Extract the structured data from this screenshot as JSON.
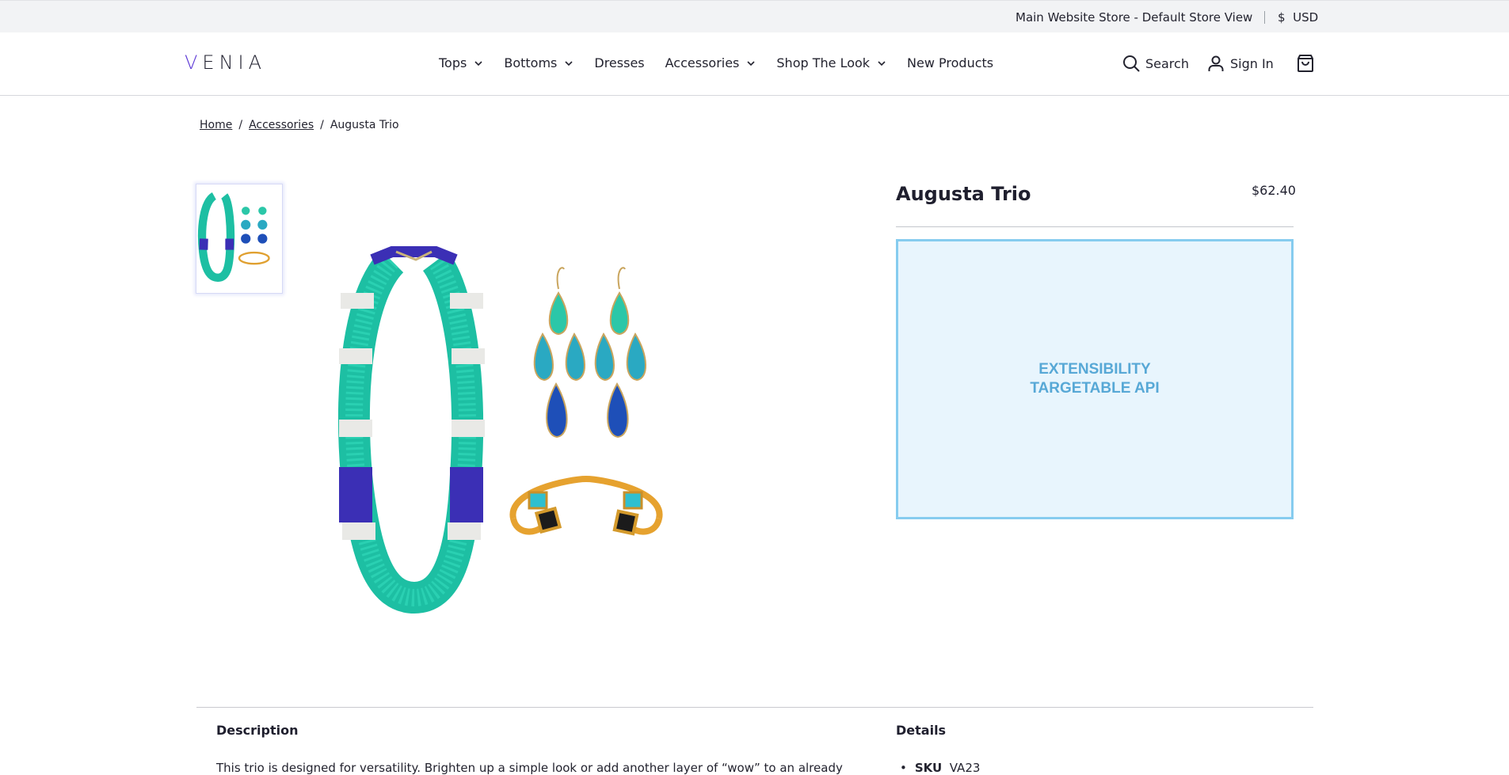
{
  "topbar": {
    "store_view": "Main Website Store - Default Store View",
    "currency_symbol": "$",
    "currency": "USD"
  },
  "header": {
    "logo": "VENIA",
    "nav": [
      {
        "label": "Tops",
        "has_dropdown": true
      },
      {
        "label": "Bottoms",
        "has_dropdown": true
      },
      {
        "label": "Dresses",
        "has_dropdown": false
      },
      {
        "label": "Accessories",
        "has_dropdown": true
      },
      {
        "label": "Shop The Look",
        "has_dropdown": true
      },
      {
        "label": "New Products",
        "has_dropdown": false
      }
    ],
    "search_label": "Search",
    "signin_label": "Sign In"
  },
  "breadcrumb": {
    "home": "Home",
    "category": "Accessories",
    "current": "Augusta Trio",
    "separator": "/"
  },
  "product": {
    "name": "Augusta Trio",
    "price": "$62.40",
    "extensibility_line1": "EXTENSIBILITY",
    "extensibility_line2": "TARGETABLE API"
  },
  "lower": {
    "description_heading": "Description",
    "description_text": "This trio is designed for versatility. Brighten up a simple look or add another layer of “wow” to an already",
    "details_heading": "Details",
    "sku_label": "SKU",
    "sku_value": "VA23"
  },
  "colors": {
    "accent": "#5d39d6",
    "extensibility_bg": "#e8f5fd",
    "extensibility_border": "#86ccef",
    "extensibility_text": "#57a8d6"
  }
}
